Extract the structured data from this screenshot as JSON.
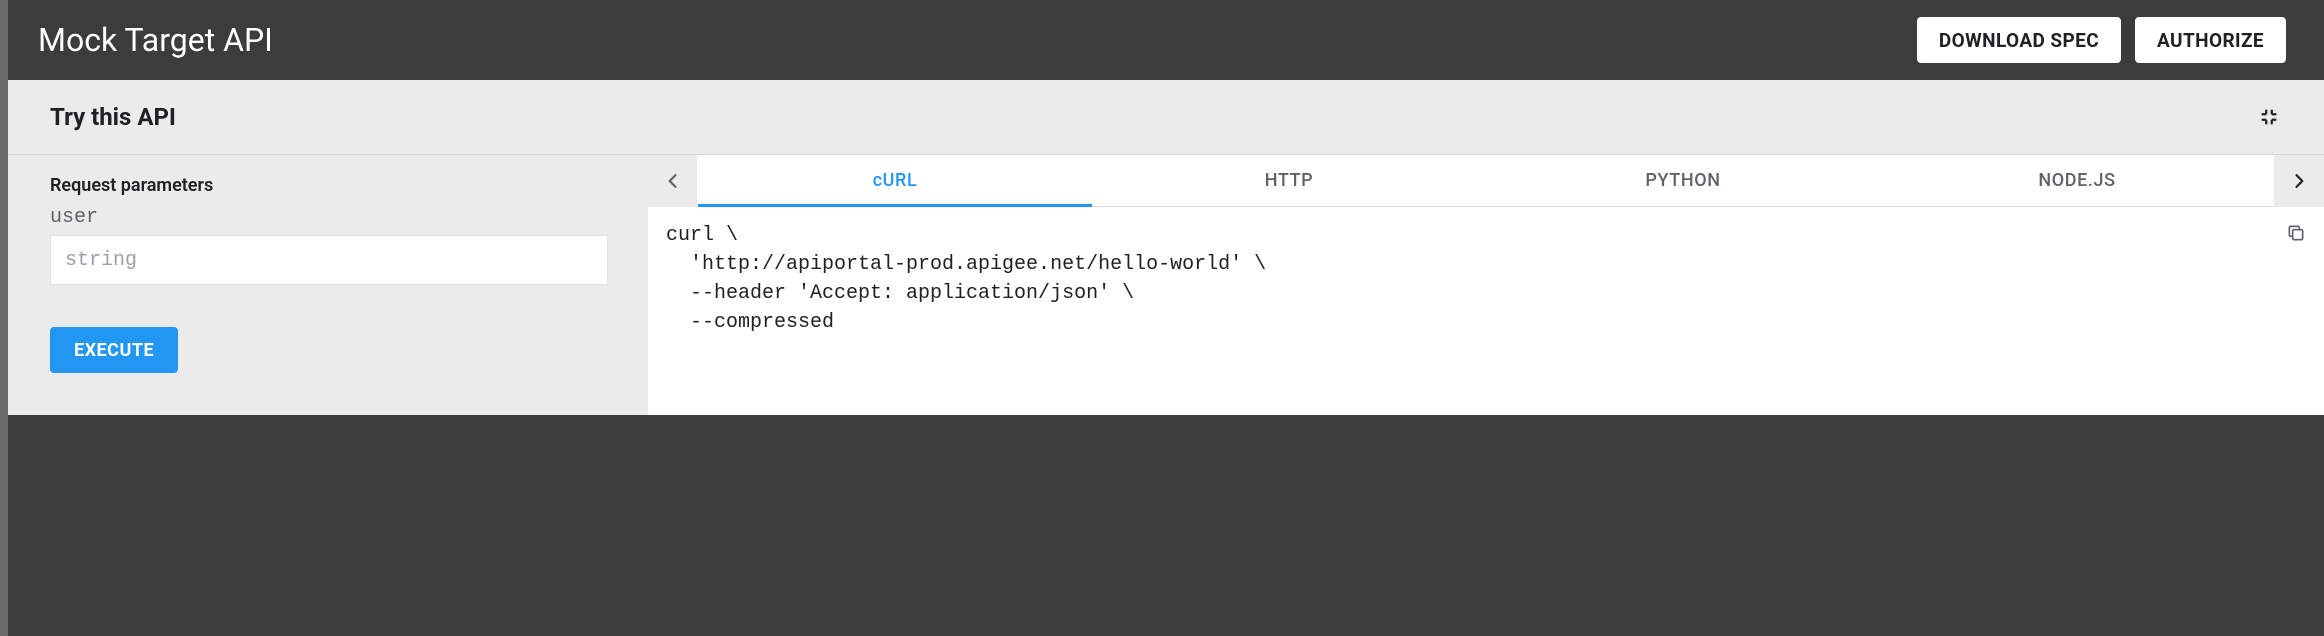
{
  "header": {
    "title": "Mock Target API",
    "download_label": "DOWNLOAD SPEC",
    "authorize_label": "AUTHORIZE"
  },
  "panel": {
    "title": "Try this API"
  },
  "request": {
    "section_title": "Request parameters",
    "param_name": "user",
    "param_placeholder": "string",
    "execute_label": "EXECUTE"
  },
  "tabs": {
    "items": [
      "cURL",
      "HTTP",
      "PYTHON",
      "NODE.JS"
    ],
    "active_index": 0
  },
  "code": {
    "curl": "curl \\\n  'http://apiportal-prod.apigee.net/hello-world' \\\n  --header 'Accept: application/json' \\\n  --compressed"
  }
}
